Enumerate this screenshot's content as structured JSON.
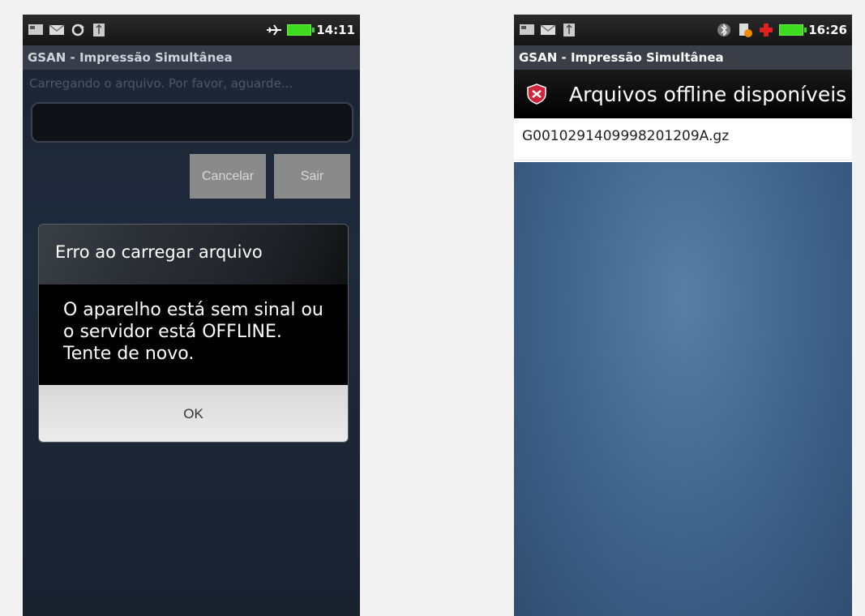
{
  "left": {
    "status_time": "14:11",
    "app_title": "GSAN - Impressão Simultânea",
    "loading_text": "Carregando o arquivo. Por favor, aguarde...",
    "cancel_label": "Cancelar",
    "exit_label": "Sair",
    "dialog": {
      "title": "Erro ao carregar arquivo",
      "message_line1": "O aparelho está sem sinal ou",
      "message_line2": "o servidor está OFFLINE.",
      "message_line3": "Tente de novo.",
      "ok_label": "OK"
    }
  },
  "right": {
    "status_time": "16:26",
    "app_title": "GSAN - Impressão Simultânea",
    "section_title": "Arquivos offline disponíveis",
    "files": [
      "G0010291409998201209A.gz"
    ]
  },
  "colors": {
    "battery": "#3ddc1e",
    "plus_icon": "#e02020",
    "error_icon": "#d0243a"
  }
}
